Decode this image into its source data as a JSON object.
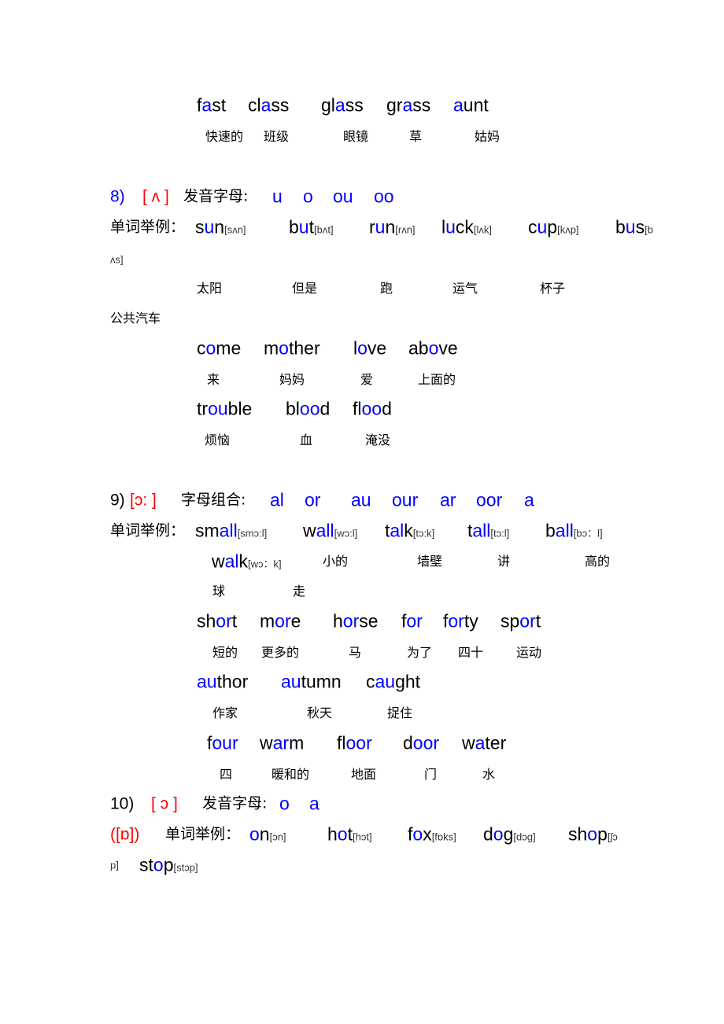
{
  "colors": {
    "highlight": "#0000ff",
    "phoneme": "#ff0000",
    "text": "#000000"
  },
  "lines": [
    [
      {
        "pre": "f",
        "hi": "a",
        "post": "st"
      },
      {
        "pre": "cl",
        "hi": "a",
        "post": "ss"
      },
      {
        "pre": "gl",
        "hi": "a",
        "post": "ss"
      },
      {
        "pre": "gr",
        "hi": "a",
        "post": "ss"
      },
      {
        "pre": "",
        "hi": "a",
        "post": "unt"
      }
    ],
    [
      {
        "t": "快速的"
      },
      {
        "t": "班级"
      },
      {
        "t": "眼镜"
      },
      {
        "t": "草"
      },
      {
        "t": "姑妈"
      }
    ],
    [
      {
        "t": "8)",
        "c": "blue",
        "s": "mk"
      },
      {
        "t": "[ ʌ ]",
        "c": "red",
        "s": "mk"
      },
      {
        "t": "发音字母:",
        "s": "label"
      },
      {
        "t": "u",
        "c": "blue",
        "s": "en"
      },
      {
        "t": "o",
        "c": "blue",
        "s": "en"
      },
      {
        "t": "ou",
        "c": "blue",
        "s": "en"
      },
      {
        "t": "oo",
        "c": "blue",
        "s": "en"
      }
    ],
    [
      {
        "t": "单词举例：",
        "s": "label"
      },
      {
        "pre": "s",
        "hi": "u",
        "post": "n",
        "ph": "[sʌn]"
      },
      {
        "pre": "b",
        "hi": "u",
        "post": "t",
        "ph": "[bʌt]"
      },
      {
        "pre": "r",
        "hi": "u",
        "post": "n",
        "ph": "[rʌn]"
      },
      {
        "pre": "l",
        "hi": "u",
        "post": "ck",
        "ph": "[lʌk]"
      },
      {
        "pre": "c",
        "hi": "u",
        "post": "p",
        "ph": "[kʌp]"
      },
      {
        "pre": "b",
        "hi": "u",
        "post": "s",
        "ph": "[b"
      }
    ],
    [
      {
        "t": "ʌs]",
        "s": "ph"
      }
    ],
    [
      {
        "t": "太阳"
      },
      {
        "t": "但是"
      },
      {
        "t": "跑"
      },
      {
        "t": "运气"
      },
      {
        "t": "杯子"
      }
    ],
    [
      {
        "t": "公共汽车"
      }
    ],
    [
      {
        "pre": "c",
        "hi": "o",
        "post": "me"
      },
      {
        "pre": "m",
        "hi": "o",
        "post": "ther"
      },
      {
        "pre": "l",
        "hi": "o",
        "post": "ve"
      },
      {
        "pre": "ab",
        "hi": "o",
        "post": "ve"
      }
    ],
    [
      {
        "t": "来"
      },
      {
        "t": "妈妈"
      },
      {
        "t": "爱"
      },
      {
        "t": "上面的"
      }
    ],
    [
      {
        "pre": "tr",
        "hi": "ou",
        "post": "ble"
      },
      {
        "pre": "bl",
        "hi": "oo",
        "post": "d"
      },
      {
        "pre": "fl",
        "hi": "oo",
        "post": "d"
      }
    ],
    [
      {
        "t": "烦恼"
      },
      {
        "t": "血"
      },
      {
        "t": "淹没"
      }
    ],
    [
      {
        "t": "9)",
        "s": "mk"
      },
      {
        "t": "[ɔ: ]",
        "c": "red",
        "s": "mk"
      },
      {
        "t": "字母组合:",
        "s": "label"
      },
      {
        "t": "al",
        "c": "blue",
        "s": "en"
      },
      {
        "t": "or",
        "c": "blue",
        "s": "en"
      },
      {
        "t": "au",
        "c": "blue",
        "s": "en"
      },
      {
        "t": "our",
        "c": "blue",
        "s": "en"
      },
      {
        "t": "ar",
        "c": "blue",
        "s": "en"
      },
      {
        "t": "oor",
        "c": "blue",
        "s": "en"
      },
      {
        "t": "a",
        "c": "blue",
        "s": "en"
      }
    ],
    [
      {
        "t": "单词举例：",
        "s": "label"
      },
      {
        "pre": "sm",
        "hi": "all",
        "post": "",
        "ph": "[smɔ:l]"
      },
      {
        "pre": "w",
        "hi": "all",
        "post": "",
        "ph": "[wɔ:l]"
      },
      {
        "pre": "t",
        "hi": "al",
        "post": "k",
        "ph": "[tɔ:k]"
      },
      {
        "pre": "t",
        "hi": "all",
        "post": "",
        "ph": "[tɔ:l]"
      },
      {
        "pre": "b",
        "hi": "all",
        "post": "",
        "ph": "[bɔ：l]"
      }
    ],
    [
      {
        "pre": "w",
        "hi": "al",
        "post": "k",
        "ph": "[wɔ：k]"
      },
      {
        "t": "小的"
      },
      {
        "t": "墙壁"
      },
      {
        "t": "讲"
      },
      {
        "t": "高的"
      }
    ],
    [
      {
        "t": "球"
      },
      {
        "t": "走"
      }
    ],
    [
      {
        "pre": "sh",
        "hi": "or",
        "post": "t"
      },
      {
        "pre": "m",
        "hi": "or",
        "post": "e"
      },
      {
        "pre": "h",
        "hi": "or",
        "post": "se"
      },
      {
        "pre": "f",
        "hi": "or",
        "post": ""
      },
      {
        "pre": "f",
        "hi": "or",
        "post": "ty"
      },
      {
        "pre": "sp",
        "hi": "or",
        "post": "t"
      }
    ],
    [
      {
        "t": "短的"
      },
      {
        "t": "更多的"
      },
      {
        "t": "马"
      },
      {
        "t": "为了"
      },
      {
        "t": "四十"
      },
      {
        "t": "运动"
      }
    ],
    [
      {
        "pre": "",
        "hi": "au",
        "post": "thor"
      },
      {
        "pre": "",
        "hi": "au",
        "post": "tumn"
      },
      {
        "pre": "c",
        "hi": "au",
        "post": "ght"
      }
    ],
    [
      {
        "t": "作家"
      },
      {
        "t": "秋天"
      },
      {
        "t": "捉住"
      }
    ],
    [
      {
        "pre": "f",
        "hi": "our",
        "post": ""
      },
      {
        "pre": "w",
        "hi": "ar",
        "post": "m"
      },
      {
        "pre": "fl",
        "hi": "oor",
        "post": ""
      },
      {
        "pre": "d",
        "hi": "oor",
        "post": ""
      },
      {
        "pre": "w",
        "hi": "a",
        "post": "ter"
      }
    ],
    [
      {
        "t": "四"
      },
      {
        "t": "暖和的"
      },
      {
        "t": "地面"
      },
      {
        "t": "门"
      },
      {
        "t": "水"
      }
    ],
    [
      {
        "t": "10)",
        "s": "mk"
      },
      {
        "t": "[ ɔ ]",
        "c": "red",
        "s": "mk"
      },
      {
        "t": "发音字母:",
        "s": "label"
      },
      {
        "t": "o",
        "c": "blue",
        "s": "en"
      },
      {
        "t": "a",
        "c": "blue",
        "s": "en"
      }
    ],
    [
      {
        "t": "([ɒ])",
        "c": "red",
        "s": "mk"
      },
      {
        "t": "单词举例：",
        "s": "label"
      },
      {
        "pre": "",
        "hi": "o",
        "post": "n",
        "ph": "[ɔn]"
      },
      {
        "pre": "h",
        "hi": "o",
        "post": "t",
        "ph": "[hɔt]"
      },
      {
        "pre": "f",
        "hi": "o",
        "post": "x",
        "ph": "[fɒks]"
      },
      {
        "pre": "d",
        "hi": "o",
        "post": "g",
        "ph": "[dɔg]"
      },
      {
        "pre": "sh",
        "hi": "o",
        "post": "p",
        "ph": "[ʃɔ"
      }
    ],
    [
      {
        "t": "p]",
        "s": "ph"
      },
      {
        "pre": "st",
        "hi": "o",
        "post": "p",
        "ph": "[stɔp]"
      }
    ]
  ]
}
